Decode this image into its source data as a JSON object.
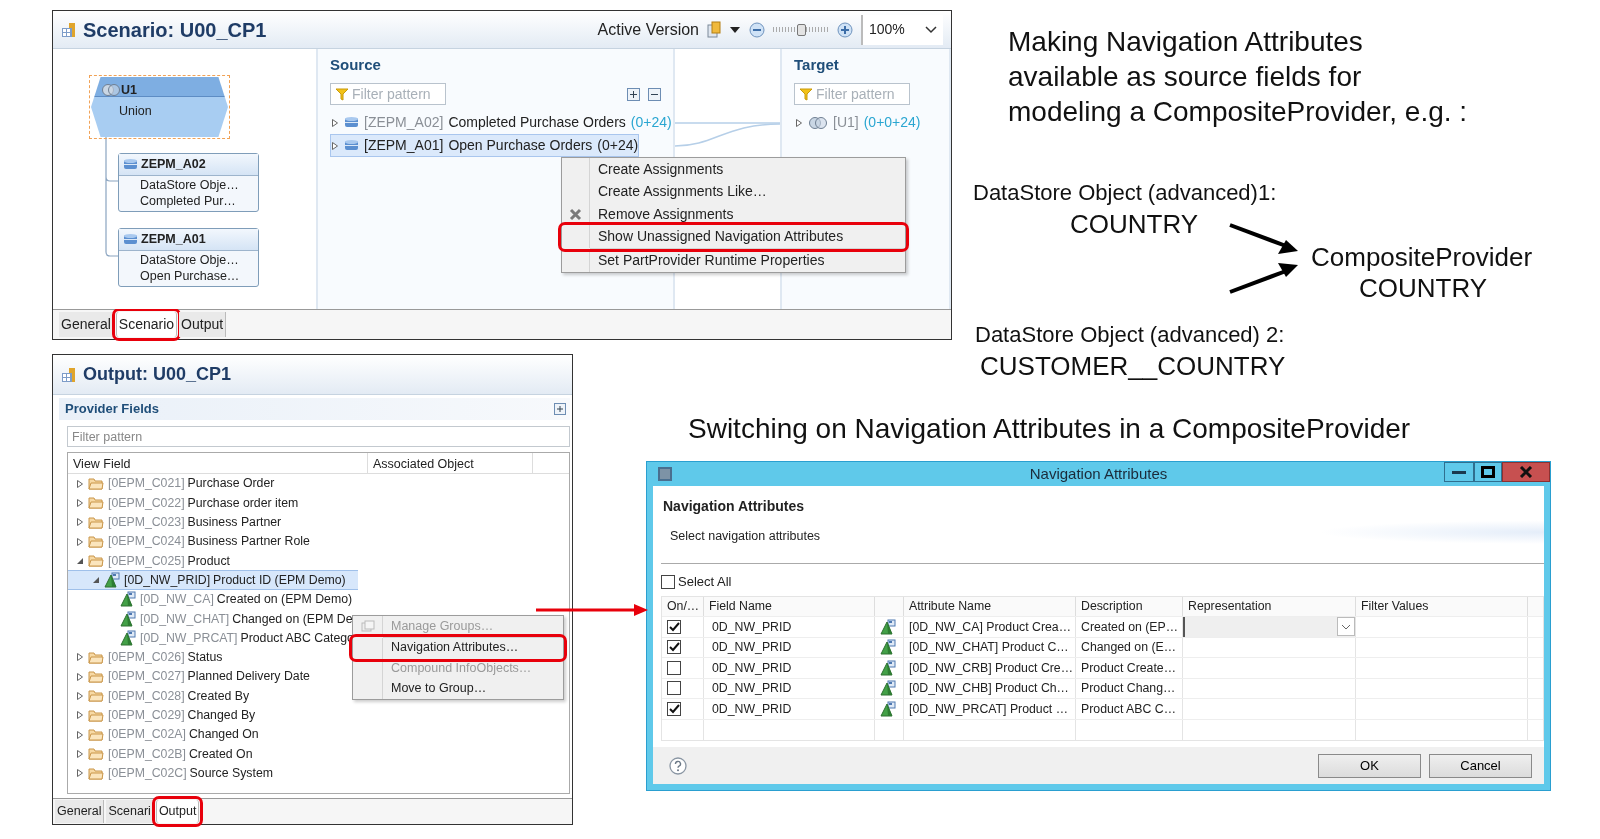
{
  "scenario_window": {
    "title": "Scenario: U00_CP1",
    "version_label": "Active Version",
    "zoom_slider": {
      "level": 0.5
    },
    "zoom": "100%",
    "union_node": {
      "name": "U1",
      "type": "Union"
    },
    "part_nodes": [
      {
        "name": "ZEPM_A02",
        "type": "DataStore Obje…",
        "description": "Completed Pur…"
      },
      {
        "name": "ZEPM_A01",
        "type": "DataStore Obje…",
        "description": "Open Purchase…"
      }
    ],
    "source": {
      "title": "Source",
      "placeholder": "Filter pattern",
      "items": [
        {
          "key": "[ZEPM_A02]",
          "label": "Completed Purchase Orders",
          "count": "(0+24)",
          "selected": false
        },
        {
          "key": "[ZEPM_A01]",
          "label": "Open Purchase Orders",
          "count": "(0+24)",
          "selected": true
        }
      ]
    },
    "target": {
      "title": "Target",
      "placeholder": "Filter pattern",
      "items": [
        {
          "key": "[U1]",
          "count": "(0+0+24)",
          "selected": false
        }
      ]
    },
    "context_menu": {
      "groups": [
        {
          "items": [
            {
              "label": "Create Assignments",
              "kind": "plain",
              "highlighted": false
            },
            {
              "label": "Create Assignments Like…",
              "kind": "plain",
              "highlighted": false
            },
            {
              "label": "Remove Assignments",
              "kind": "remove",
              "highlighted": false
            },
            {
              "label": "Show Unassigned Navigation Attributes",
              "kind": "plain",
              "highlighted": true
            }
          ]
        },
        {
          "items": [
            {
              "label": "Set PartProvider Runtime Properties",
              "kind": "plain",
              "highlighted": false
            }
          ]
        }
      ]
    },
    "tabs": [
      {
        "label": "General",
        "selected": false,
        "highlighted": false
      },
      {
        "label": "Scenario",
        "selected": true,
        "highlighted": true
      },
      {
        "label": "Output",
        "selected": false,
        "highlighted": false
      }
    ]
  },
  "output_window": {
    "title": "Output: U00_CP1",
    "section": "Provider Fields",
    "placeholder": "Filter pattern",
    "columns": [
      "View Field",
      "Associated Object"
    ],
    "tree": [
      {
        "kind": "folder",
        "key": "[0EPM_C021]",
        "label": "Purchase Order",
        "expanded": false,
        "selected": false
      },
      {
        "kind": "folder",
        "key": "[0EPM_C022]",
        "label": "Purchase order item",
        "expanded": false,
        "selected": false
      },
      {
        "kind": "folder",
        "key": "[0EPM_C023]",
        "label": "Business Partner",
        "expanded": false,
        "selected": false
      },
      {
        "kind": "folder",
        "key": "[0EPM_C024]",
        "label": "Business Partner Role",
        "expanded": false,
        "selected": false
      },
      {
        "kind": "folder",
        "key": "[0EPM_C025]",
        "label": "Product",
        "expanded": true,
        "selected": false,
        "children": [
          {
            "kind": "infoobject",
            "key": "[0D_NW_PRID]",
            "label": "Product ID (EPM Demo)",
            "expanded": true,
            "selected": true,
            "children": [
              {
                "kind": "infoobject",
                "key": "[0D_NW_CA]",
                "label": "Created on (EPM Demo)",
                "selected": false
              },
              {
                "kind": "infoobject",
                "key": "[0D_NW_CHAT]",
                "label": "Changed on (EPM De",
                "selected": false
              },
              {
                "kind": "infoobject",
                "key": "[0D_NW_PRCAT]",
                "label": "Product ABC Catego",
                "selected": false
              }
            ]
          }
        ]
      },
      {
        "kind": "folder",
        "key": "[0EPM_C026]",
        "label": "Status",
        "expanded": false,
        "selected": false
      },
      {
        "kind": "folder",
        "key": "[0EPM_C027]",
        "label": "Planned Delivery Date",
        "expanded": false,
        "selected": false
      },
      {
        "kind": "folder",
        "key": "[0EPM_C028]",
        "label": "Created By",
        "expanded": false,
        "selected": false
      },
      {
        "kind": "folder",
        "key": "[0EPM_C029]",
        "label": "Changed By",
        "expanded": false,
        "selected": false
      },
      {
        "kind": "folder",
        "key": "[0EPM_C02A]",
        "label": "Changed On",
        "expanded": false,
        "selected": false
      },
      {
        "kind": "folder",
        "key": "[0EPM_C02B]",
        "label": "Created On",
        "expanded": false,
        "selected": false
      },
      {
        "kind": "folder",
        "key": "[0EPM_C02C]",
        "label": "Source System",
        "expanded": false,
        "selected": false
      }
    ],
    "context_menu": {
      "groups": [
        {
          "items": [
            {
              "label": "Manage Groups…",
              "disabled": true,
              "highlighted": false
            }
          ]
        },
        {
          "items": [
            {
              "label": "Navigation Attributes…",
              "disabled": false,
              "highlighted": true
            },
            {
              "label": "Compound InfoObjects…",
              "disabled": true,
              "highlighted": false
            },
            {
              "label": "Move to Group…",
              "disabled": false,
              "highlighted": false
            }
          ]
        }
      ]
    },
    "tabs": [
      {
        "label": "General",
        "selected": false,
        "highlighted": false
      },
      {
        "label": "Scenari",
        "selected": false,
        "highlighted": false
      },
      {
        "label": "Output",
        "selected": true,
        "highlighted": true
      }
    ]
  },
  "dialog": {
    "title": "Navigation Attributes",
    "heading": "Navigation Attributes",
    "subtitle": "Select navigation attributes",
    "select_all": {
      "label": "Select All",
      "checked": false
    },
    "columns": [
      "On/…",
      "Field Name",
      "",
      "Attribute Name",
      "Description",
      "Representation",
      "Filter Values"
    ],
    "rows": [
      {
        "on": true,
        "field": "0D_NW_PRID",
        "attribute": "[0D_NW_CA] Product Crea…",
        "description": "Created on (EP…",
        "editing": true
      },
      {
        "on": true,
        "field": "0D_NW_PRID",
        "attribute": "[0D_NW_CHAT] Product C…",
        "description": "Changed on (E…",
        "editing": false
      },
      {
        "on": false,
        "field": "0D_NW_PRID",
        "attribute": "[0D_NW_CRB] Product Cre…",
        "description": "Product Create…",
        "editing": false
      },
      {
        "on": false,
        "field": "0D_NW_PRID",
        "attribute": "[0D_NW_CHB] Product Ch…",
        "description": "Product Chang…",
        "editing": false
      },
      {
        "on": true,
        "field": "0D_NW_PRID",
        "attribute": "[0D_NW_PRCAT] Product …",
        "description": "Product ABC C…",
        "editing": false
      }
    ],
    "buttons": [
      "OK",
      "Cancel"
    ]
  },
  "intro": [
    "Making Navigation Attributes",
    "available as source fields for",
    "modeling a CompositeProvider, e.g. :"
  ],
  "example": {
    "source_1": {
      "label": "DataStore Object (advanced)1:",
      "field": "COUNTRY"
    },
    "target": {
      "label": "CompositeProvider",
      "field": "COUNTRY"
    },
    "source_2": {
      "label": "DataStore Object (advanced) 2:",
      "field": "CUSTOMER__COUNTRY"
    }
  },
  "caption": "Switching on Navigation Attributes in a CompositeProvider"
}
